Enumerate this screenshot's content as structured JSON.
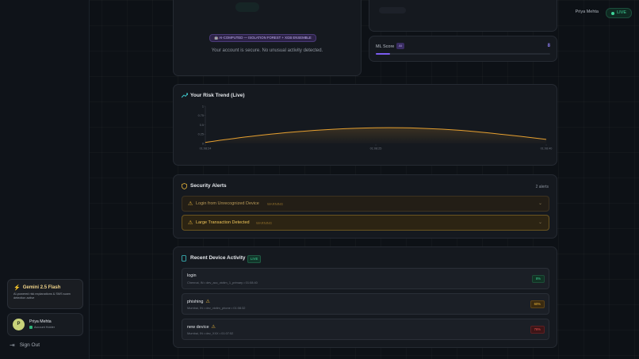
{
  "topbar": {
    "user_name": "Priya Mehta",
    "live_label": "LIVE"
  },
  "status": {
    "ai_badge": "🤖 AI-COMPUTED — ISOLATION FOREST + XGB ENSEMBLE",
    "message": "Your account is secure. No unusual activity detected."
  },
  "ml": {
    "label": "ML Score",
    "ai_tag": "AI",
    "value": "8",
    "value_fraction": 0.08
  },
  "risk_trend": {
    "title": "Your Risk Trend (Live)"
  },
  "chart_data": {
    "type": "area",
    "title": "Your Risk Trend (Live)",
    "x": [
      "01:08:24",
      "01:08:25",
      "01:08:40"
    ],
    "x_ticks": [
      "01:08:24",
      "01:08:25",
      "01:08:40"
    ],
    "y_ticks": [
      "0",
      "0.25",
      "0.5",
      "0.75",
      "1"
    ],
    "ylim": [
      0,
      1
    ],
    "series": [
      {
        "values": [
          0.03,
          0.18,
          0.3,
          0.38,
          0.42,
          0.41,
          0.35,
          0.24,
          0.11
        ]
      }
    ],
    "series_color": "#e6a030",
    "grid": false
  },
  "alerts": {
    "title": "Security Alerts",
    "count": "2 alerts",
    "items": [
      {
        "title": "Login from Unrecognized Device",
        "severity": "WARNING"
      },
      {
        "title": "Large Transaction Detected",
        "severity": "WARNING"
      }
    ]
  },
  "activity": {
    "title": "Recent Device Activity",
    "live_tag": "LIVE",
    "items": [
      {
        "name": "login",
        "meta": "Chennai, IN • dev_acc_victim_1_primary • 01:08:40",
        "score": "8%",
        "level": "low"
      },
      {
        "name": "phishing",
        "meta": "Mumbai, IN • dev_victim_phone • 01:08:32",
        "score": "60%",
        "level": "med"
      },
      {
        "name": "new device",
        "meta": "Mumbai, IN • dev_XXX • 01:07:52",
        "score": "76%",
        "level": "high"
      }
    ]
  },
  "sidebar": {
    "gemini_title": "Gemini 2.5 Flash",
    "gemini_desc": "AI-powered risk explanations & SMS scam detection active",
    "user_initial": "P",
    "user_name": "Priya Mehta",
    "user_role": "Account Holder",
    "sign_out": "Sign Out"
  },
  "colors": {
    "accent_green": "#3fd69a",
    "warning": "#e6b43a",
    "danger": "#ef5350",
    "ai_purple": "#7b5cf0"
  }
}
